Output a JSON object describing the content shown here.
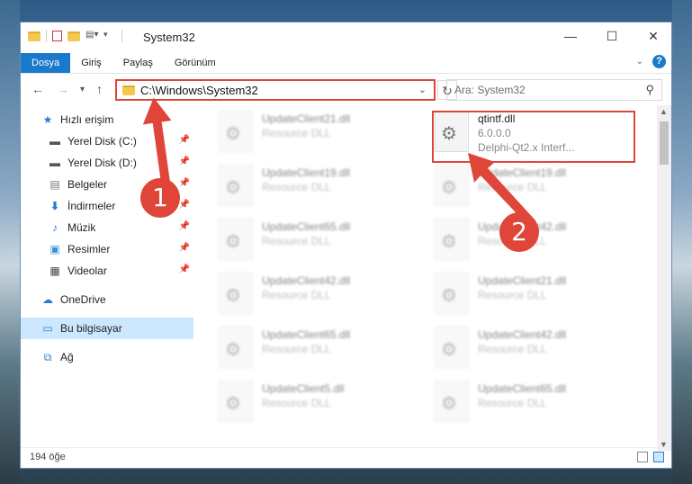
{
  "window": {
    "title": "System32",
    "minimize_glyph": "—",
    "maximize_glyph": "☐",
    "close_glyph": "✕"
  },
  "ribbon": {
    "tabs": [
      "Dosya",
      "Giriş",
      "Paylaş",
      "Görünüm"
    ],
    "active_tab": "Dosya",
    "help_label": "?"
  },
  "nav": {
    "back_glyph": "←",
    "forward_glyph": "→",
    "recent_glyph": "▾",
    "up_glyph": "↑",
    "address": "C:\\Windows\\System32",
    "search_placeholder": "Ara: System32",
    "refresh_glyph": "↻"
  },
  "sidebar": {
    "items": [
      {
        "label": "Hızlı erişim",
        "icon": "star-icon",
        "pinned": false
      },
      {
        "label": "Yerel Disk (C:)",
        "icon": "drive-icon",
        "pinned": true
      },
      {
        "label": "Yerel Disk (D:)",
        "icon": "drive-icon",
        "pinned": true
      },
      {
        "label": "Belgeler",
        "icon": "documents-icon",
        "pinned": true
      },
      {
        "label": "İndirmeler",
        "icon": "download-icon",
        "pinned": true
      },
      {
        "label": "Müzik",
        "icon": "music-icon",
        "pinned": true
      },
      {
        "label": "Resimler",
        "icon": "pictures-icon",
        "pinned": true
      },
      {
        "label": "Videolar",
        "icon": "video-icon",
        "pinned": true
      },
      {
        "label": "OneDrive",
        "icon": "cloud-icon",
        "pinned": false
      },
      {
        "label": "Bu bilgisayar",
        "icon": "computer-icon",
        "pinned": false
      },
      {
        "label": "Ağ",
        "icon": "network-icon",
        "pinned": false
      }
    ],
    "selected": "Bu bilgisayar"
  },
  "files": [
    {
      "name": "UpdateClient21.dll",
      "type": "Resource DLL",
      "blurred": true
    },
    {
      "name": "qtintf.dll",
      "version": "6.0.0.0",
      "desc": "Delphi-Qt2.x Interf...",
      "blurred": false,
      "highlighted": true
    },
    {
      "name": "UpdateClient19.dll",
      "type": "Resource DLL",
      "blurred": true
    },
    {
      "name": "UpdateClient19.dll",
      "type": "Resource DLL",
      "blurred": true
    },
    {
      "name": "UpdateClient65.dll",
      "type": "Resource DLL",
      "blurred": true
    },
    {
      "name": "UpdateClient42.dll",
      "type": "Resource DLL",
      "blurred": true
    },
    {
      "name": "UpdateClient42.dll",
      "type": "Resource DLL",
      "blurred": true
    },
    {
      "name": "UpdateClient21.dll",
      "type": "Resource DLL",
      "blurred": true
    },
    {
      "name": "UpdateClient65.dll",
      "type": "Resource DLL",
      "blurred": true
    },
    {
      "name": "UpdateClient42.dll",
      "type": "Resource DLL",
      "blurred": true
    },
    {
      "name": "UpdateClient5.dll",
      "type": "Resource DLL",
      "blurred": true
    },
    {
      "name": "UpdateClient65.dll",
      "type": "Resource DLL",
      "blurred": true
    }
  ],
  "status": {
    "item_count": "194 öğe"
  },
  "annotations": {
    "step1": "1",
    "step2": "2",
    "color": "#e0453a"
  },
  "colors": {
    "accent": "#1979ca",
    "selection": "#cce8ff"
  }
}
